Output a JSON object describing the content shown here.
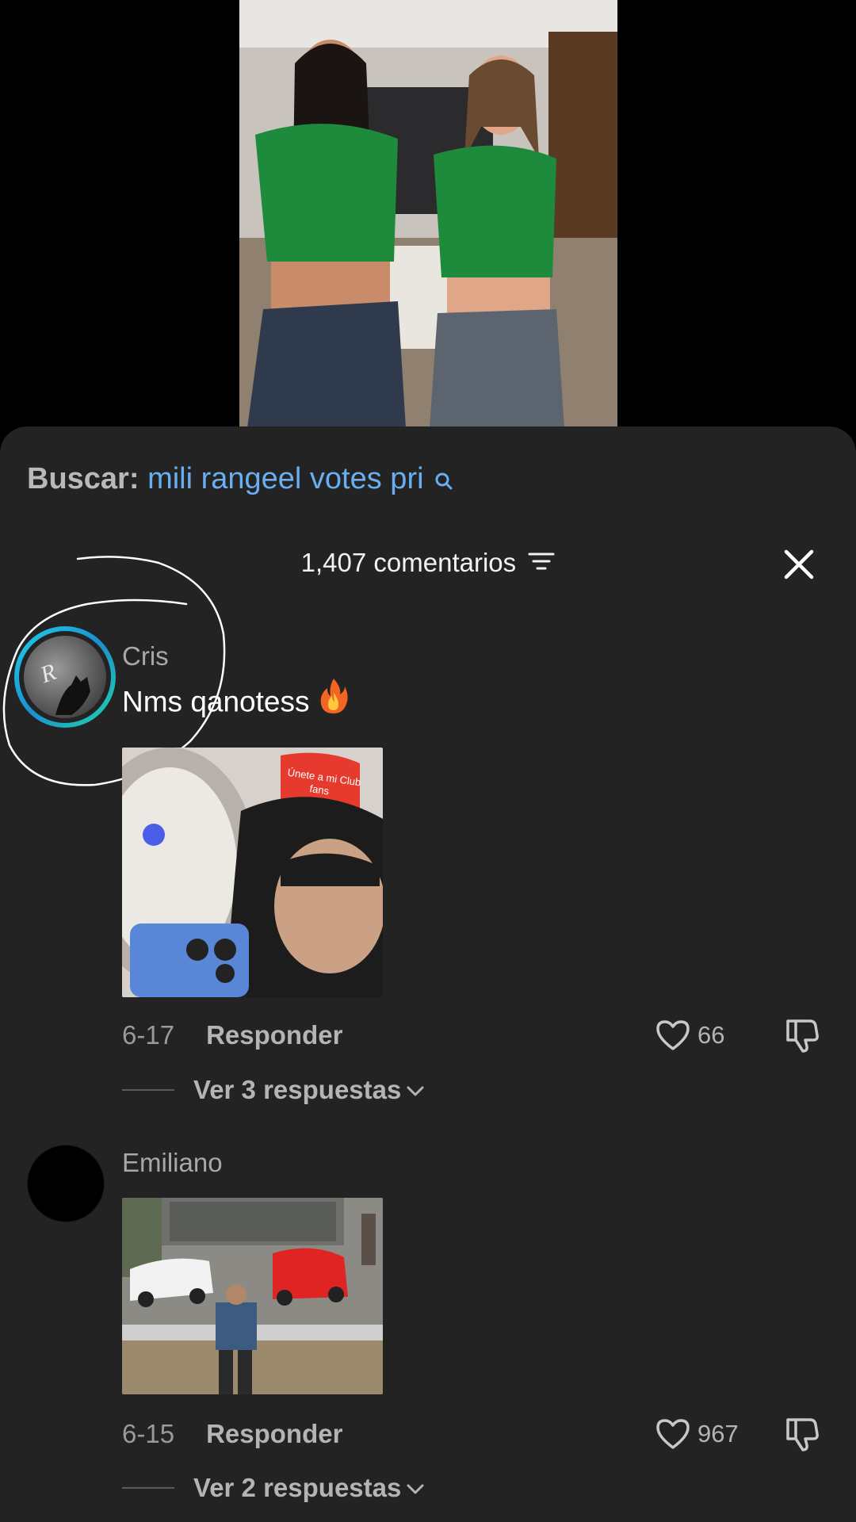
{
  "video": {
    "description_icon": "video-thumbnail"
  },
  "search": {
    "prefix": "Buscar:",
    "query": "mili rangeel votes pri",
    "icon": "search-icon"
  },
  "comments_header": {
    "count_label": "1,407 comentarios",
    "filter_icon": "filter-icon",
    "close_icon": "close-icon"
  },
  "comments": [
    {
      "username": "Cris",
      "text": "Nms qanotess",
      "emoji": "fire-emoji",
      "has_sticker": true,
      "sticker_caption": "Únete a mi Club fans",
      "date": "6-17",
      "reply_label": "Responder",
      "likes": "66",
      "replies_label": "Ver 3 respuestas"
    },
    {
      "username": "Emiliano",
      "text": "",
      "has_sticker": true,
      "date": "6-15",
      "reply_label": "Responder",
      "likes": "967",
      "replies_label": "Ver 2 respuestas"
    }
  ],
  "colors": {
    "sheet_bg": "#232323",
    "search_query": "#6aaef2",
    "avatar_ring": "#1fd1e8"
  }
}
